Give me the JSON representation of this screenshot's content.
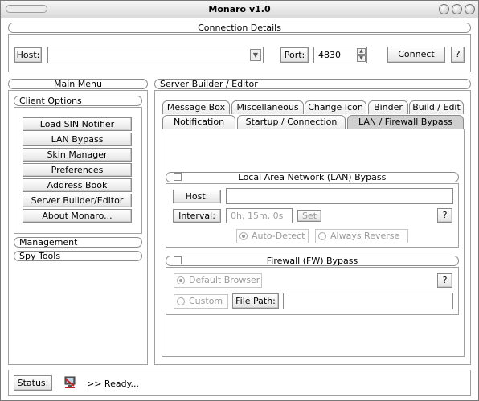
{
  "window": {
    "title": "Monaro v1.0"
  },
  "connection": {
    "header": "Connection Details",
    "host_button": "Host:",
    "host_value": "",
    "port_button": "Port:",
    "port_value": "4830",
    "connect_button": "Connect",
    "help": "?"
  },
  "main_menu": {
    "header": "Main Menu",
    "client_options": {
      "header": "Client Options",
      "items": [
        "Load SIN Notifier",
        "LAN Bypass",
        "Skin Manager",
        "Preferences",
        "Address Book",
        "Server Builder/Editor",
        "About Monaro..."
      ]
    },
    "management": "Management",
    "spy_tools": "Spy Tools"
  },
  "server_builder": {
    "header": "Server Builder / Editor",
    "tabs_row1": [
      "Message Box",
      "Miscellaneous",
      "Change Icon",
      "Binder",
      "Build / Edit"
    ],
    "tabs_row2": [
      "Notification",
      "Startup / Connection",
      "LAN / Firewall Bypass"
    ],
    "active_tab": "LAN / Firewall Bypass",
    "lan": {
      "header": "Local Area Network (LAN) Bypass",
      "host_button": "Host:",
      "host_value": "",
      "interval_button": "Interval:",
      "interval_value": "0h, 15m, 0s",
      "set_button": "Set",
      "help": "?",
      "auto_detect": "Auto-Detect",
      "always_reverse": "Always Reverse"
    },
    "firewall": {
      "header": "Firewall (FW) Bypass",
      "default_browser": "Default Browser",
      "help": "?",
      "custom": "Custom",
      "file_path_button": "File Path:",
      "file_path_value": ""
    }
  },
  "status": {
    "button": "Status:",
    "text": ">> Ready..."
  }
}
